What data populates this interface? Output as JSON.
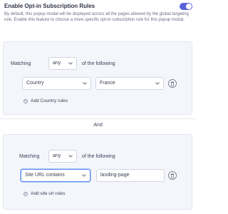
{
  "header": {
    "title": "Enable Opt-in Subscription Rules",
    "description": "By default, this popup modal will be displayed across all the pages allowed by the global targeting rule. Enable this feature to choose a more specific opt-in subscription rule for this popup modal.",
    "toggle_on": true,
    "accent_color": "#5a62d8"
  },
  "rule_groups": [
    {
      "matching_label": "Matching",
      "matching_value": "any",
      "following_label": "of the following",
      "rule": {
        "field": "Country",
        "value": "France"
      },
      "add_label": "Add Country rules"
    },
    {
      "matching_label": "Matching",
      "matching_value": "any",
      "following_label": "of the following",
      "rule": {
        "field": "Site URL contains",
        "value": "landing-page"
      },
      "add_label": "Add site url rules"
    }
  ],
  "connector": "And",
  "icons": [
    "chevron-down-icon",
    "trash-icon",
    "plus-circle-icon"
  ]
}
